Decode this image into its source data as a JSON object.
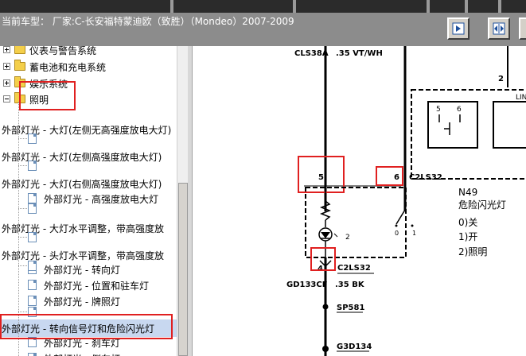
{
  "header": {
    "car_info": "当前车型： 厂家:C-长安福特蒙迪欧（致胜）（Mondeo）2007-2009",
    "buttons": [
      {
        "icon": "nav-prev-icon"
      },
      {
        "icon": "split-view-icon"
      }
    ]
  },
  "tree": {
    "items": [
      {
        "label": "仪表与警告系统",
        "kind": "folder",
        "expander": "plus"
      },
      {
        "label": "蓄电池和充电系统",
        "kind": "folder",
        "expander": "plus"
      },
      {
        "label": "娱乐系统",
        "kind": "folder",
        "expander": "plus"
      },
      {
        "label": "照明",
        "kind": "folder",
        "expander": "minus"
      },
      {
        "label": "外部灯光 - 大灯(左侧无高强度放电大灯)",
        "kind": "item"
      },
      {
        "label": "外部灯光 - 大灯(左侧高强度放电大灯)",
        "kind": "item"
      },
      {
        "label": "外部灯光 - 大灯(右侧高强度放电大灯)",
        "kind": "item"
      },
      {
        "label": "外部灯光 - 高强度放电大灯",
        "kind": "doc"
      },
      {
        "label": "外部灯光 - 大灯水平调整，带高强度放",
        "kind": "item"
      },
      {
        "label": "外部灯光 - 头灯水平调整，带高强度放",
        "kind": "item"
      },
      {
        "label": "外部灯光 - 转向灯",
        "kind": "doc"
      },
      {
        "label": "外部灯光 - 位置和驻车灯",
        "kind": "doc"
      },
      {
        "label": "外部灯光 - 牌照灯",
        "kind": "doc"
      },
      {
        "label": "外部灯光 - 转向信号灯和危险闪光灯",
        "kind": "item",
        "selected": true
      },
      {
        "label": "外部灯光 - 刹车灯",
        "kind": "doc"
      },
      {
        "label": "外部灯光 - 倒车灯",
        "kind": "doc"
      }
    ]
  },
  "diagram": {
    "wire_top_code": "CLS38A",
    "wire_top_spec": ".35 VT/WH",
    "pin_5": "5",
    "pin_6": "6",
    "pin_4": "4",
    "pin_2_top": "2",
    "pin_2_lamp": "2",
    "connector_right": "C2LS32",
    "connector_bottom": "C2LS32",
    "module_code": "N49",
    "module_name": "危险闪光灯",
    "states": [
      "0)关",
      "1)开",
      "2)照明"
    ],
    "switch_pos_0": "0",
    "switch_pos_1": "1",
    "relay_pin_5": "5",
    "relay_pin_6": "6",
    "lin_label": "LIN",
    "wire_bottom_code": "GD133CF",
    "wire_bottom_spec": ".35 BK",
    "splice": "SP581",
    "ground": "G3D134"
  }
}
